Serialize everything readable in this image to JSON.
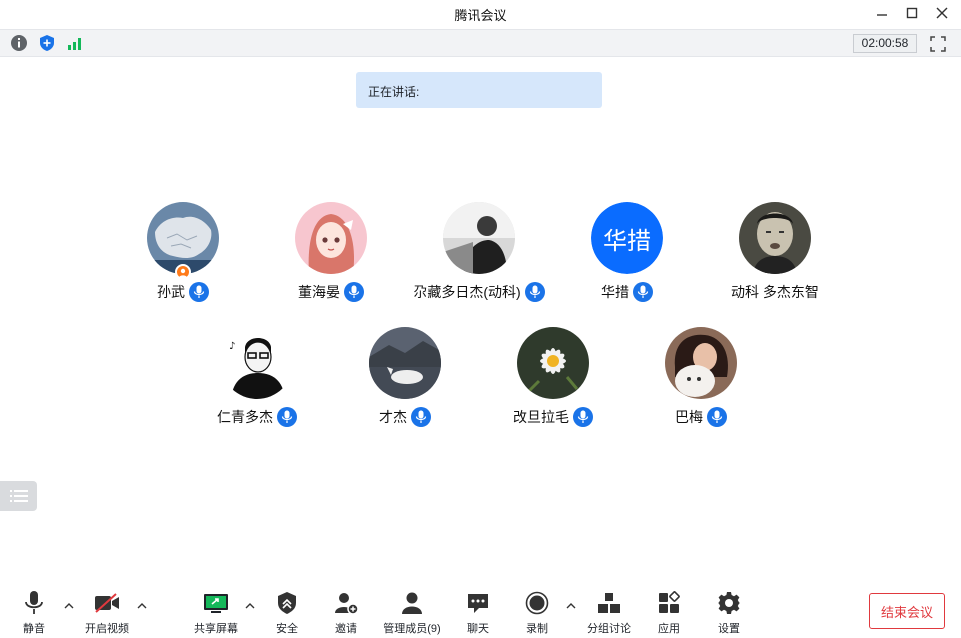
{
  "window": {
    "title": "腾讯会议"
  },
  "infobar": {
    "timer": "02:00:58",
    "icons": [
      "info-icon",
      "shield-icon",
      "signal-icon"
    ]
  },
  "speaking": {
    "label": "正在讲话:"
  },
  "participants": [
    {
      "name": "孙武",
      "host": true,
      "avatar": "map-photo"
    },
    {
      "name": "董海晏",
      "avatar": "anime-girl"
    },
    {
      "name": "尕藏多日杰(动科)",
      "avatar": "bw-photo"
    },
    {
      "name": "华措",
      "avatar_text": "华措"
    },
    {
      "name": "动科  多杰东智",
      "avatar": "bw-face"
    },
    {
      "name": "仁青多杰",
      "avatar": "cartoon-man"
    },
    {
      "name": "才杰",
      "avatar": "horse-photo"
    },
    {
      "name": "改旦拉毛",
      "avatar": "flower-photo"
    },
    {
      "name": "巴梅",
      "avatar": "girl-cat-photo"
    }
  ],
  "toolbar": {
    "mute": "静音",
    "video": "开启视频",
    "share": "共享屏幕",
    "security": "安全",
    "invite": "邀请",
    "members": "管理成员(9)",
    "chat": "聊天",
    "record": "录制",
    "breakout": "分组讨论",
    "apps": "应用",
    "settings": "设置",
    "end": "结束会议"
  },
  "colors": {
    "accent": "#1a73e8",
    "end": "#e0393e",
    "speaking_bg": "#d6e7fb"
  }
}
